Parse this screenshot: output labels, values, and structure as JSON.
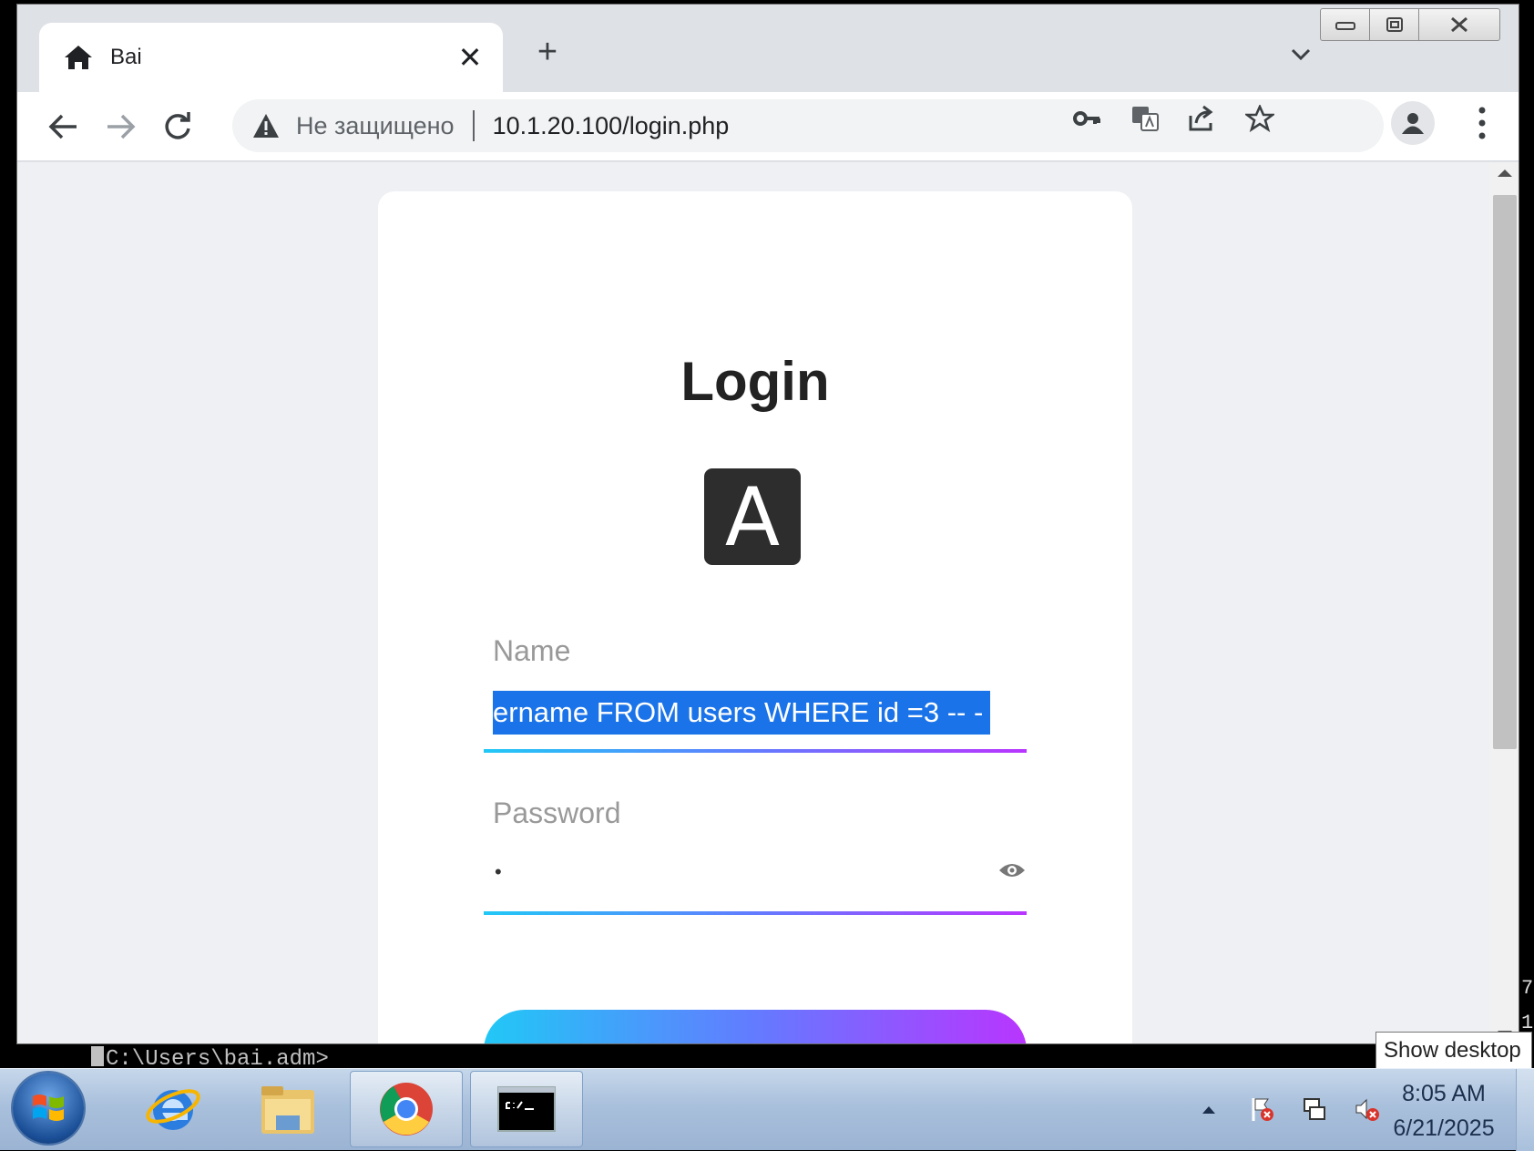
{
  "browser": {
    "tab": {
      "title": "Bai",
      "close_label": "✕",
      "icon": "home-icon"
    },
    "new_tab_label": "+",
    "address_bar": {
      "security_text": "Не защищено",
      "url": "10.1.20.100/login.php",
      "security_icon": "warning-icon"
    },
    "window_controls": [
      "minimize",
      "restore",
      "close"
    ]
  },
  "page": {
    "title": "Login",
    "logo_letter": "A",
    "name_field": {
      "label": "Name",
      "value": "ername FROM users WHERE id =3 -- -"
    },
    "password_field": {
      "label": "Password",
      "value": "•"
    }
  },
  "console": {
    "prompt": "C:\\Users\\bai.adm>",
    "side_digits": [
      "7",
      "1"
    ]
  },
  "tooltip": {
    "text": "Show desktop"
  },
  "taskbar": {
    "items": [
      "start-button",
      "internet-explorer",
      "file-explorer",
      "chrome",
      "command-prompt"
    ],
    "time": "8:05 AM",
    "date": "6/21/2025"
  },
  "colors": {
    "selection": "#1a73e8",
    "gradient_start": "#21c8f6",
    "gradient_end": "#b935ff",
    "page_background": "#eef0f3"
  }
}
